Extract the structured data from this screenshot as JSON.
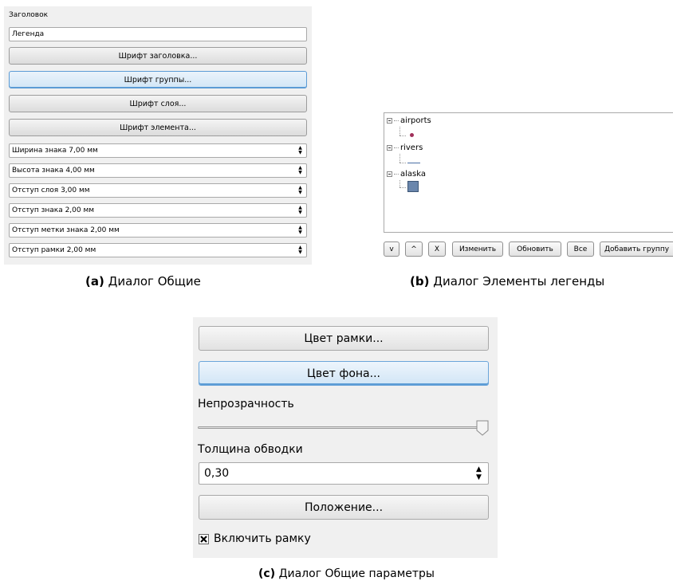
{
  "panel_a": {
    "title_label": "Заголовок",
    "title_value": "Легенда",
    "buttons": [
      "Шрифт заголовка...",
      "Шрифт группы...",
      "Шрифт слоя...",
      "Шрифт элемента..."
    ],
    "spins": [
      "Ширина знака 7,00 мм",
      "Высота знака 4,00 мм",
      "Отступ слоя 3,00 мм",
      "Отступ знака 2,00 мм",
      "Отступ метки знака 2,00 мм",
      "Отступ рамки 2,00 мм"
    ],
    "caption_tag": "(a)",
    "caption_text": "Диалог Общие"
  },
  "panel_b": {
    "tree": [
      "airports",
      "rivers",
      "alaska"
    ],
    "buttons": [
      "v",
      "^",
      "X",
      "Изменить",
      "Обновить",
      "Все",
      "Добавить группу"
    ],
    "caption_tag": "(b)",
    "caption_text": "Диалог Элементы легенды",
    "colors": {
      "airports_symbol": "#a0305a",
      "rivers_symbol": "#4a6fa5",
      "alaska_symbol": "#6a86ac"
    }
  },
  "panel_c": {
    "frame_color_btn": "Цвет рамки...",
    "bg_color_btn": "Цвет фона...",
    "opacity_label": "Непрозрачность",
    "opacity_value": 1.0,
    "stroke_label": "Толщина обводки",
    "stroke_value": "0,30",
    "position_btn": "Положение...",
    "enable_frame_label": "Включить рамку",
    "enable_frame_checked": true,
    "caption_tag": "(c)",
    "caption_text": "Диалог Общие параметры"
  }
}
